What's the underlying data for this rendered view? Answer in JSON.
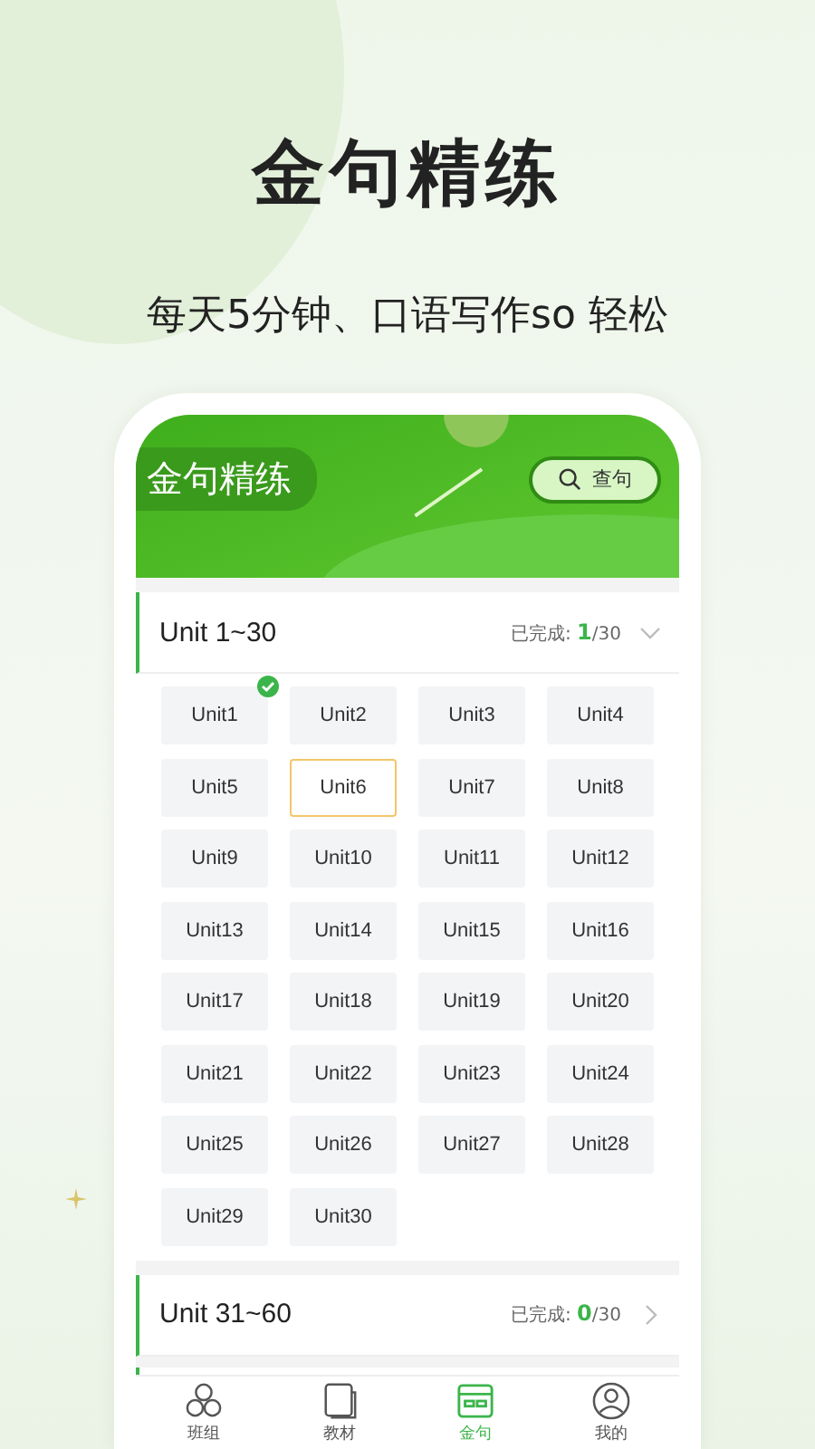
{
  "headline": "金句精练",
  "subtitle": "每天5分钟、口语写作so 轻松",
  "app_header": {
    "title": "金句精练",
    "search_button": "查句"
  },
  "sections": [
    {
      "title": "Unit 1~30",
      "done_label": "已完成: ",
      "done": "1",
      "total": "/30",
      "expanded": true,
      "units": [
        {
          "label": "Unit1",
          "completed": true,
          "selected": false
        },
        {
          "label": "Unit2",
          "completed": false,
          "selected": false
        },
        {
          "label": "Unit3",
          "completed": false,
          "selected": false
        },
        {
          "label": "Unit4",
          "completed": false,
          "selected": false
        },
        {
          "label": "Unit5",
          "completed": false,
          "selected": false
        },
        {
          "label": "Unit6",
          "completed": false,
          "selected": true
        },
        {
          "label": "Unit7",
          "completed": false,
          "selected": false
        },
        {
          "label": "Unit8",
          "completed": false,
          "selected": false
        },
        {
          "label": "Unit9",
          "completed": false,
          "selected": false
        },
        {
          "label": "Unit10",
          "completed": false,
          "selected": false
        },
        {
          "label": "Unit11",
          "completed": false,
          "selected": false
        },
        {
          "label": "Unit12",
          "completed": false,
          "selected": false
        },
        {
          "label": "Unit13",
          "completed": false,
          "selected": false
        },
        {
          "label": "Unit14",
          "completed": false,
          "selected": false
        },
        {
          "label": "Unit15",
          "completed": false,
          "selected": false
        },
        {
          "label": "Unit16",
          "completed": false,
          "selected": false
        },
        {
          "label": "Unit17",
          "completed": false,
          "selected": false
        },
        {
          "label": "Unit18",
          "completed": false,
          "selected": false
        },
        {
          "label": "Unit19",
          "completed": false,
          "selected": false
        },
        {
          "label": "Unit20",
          "completed": false,
          "selected": false
        },
        {
          "label": "Unit21",
          "completed": false,
          "selected": false
        },
        {
          "label": "Unit22",
          "completed": false,
          "selected": false
        },
        {
          "label": "Unit23",
          "completed": false,
          "selected": false
        },
        {
          "label": "Unit24",
          "completed": false,
          "selected": false
        },
        {
          "label": "Unit25",
          "completed": false,
          "selected": false
        },
        {
          "label": "Unit26",
          "completed": false,
          "selected": false
        },
        {
          "label": "Unit27",
          "completed": false,
          "selected": false
        },
        {
          "label": "Unit28",
          "completed": false,
          "selected": false
        },
        {
          "label": "Unit29",
          "completed": false,
          "selected": false
        },
        {
          "label": "Unit30",
          "completed": false,
          "selected": false
        }
      ]
    },
    {
      "title": "Unit 31~60",
      "done_label": "已完成: ",
      "done": "0",
      "total": "/30",
      "expanded": false
    }
  ],
  "tabs": [
    {
      "kind": "circles",
      "label": "班组",
      "selected": false
    },
    {
      "kind": "book",
      "label": "教材",
      "selected": false
    },
    {
      "kind": "card",
      "label": "金句",
      "selected": true
    },
    {
      "kind": "person",
      "label": "我的",
      "selected": false
    }
  ]
}
